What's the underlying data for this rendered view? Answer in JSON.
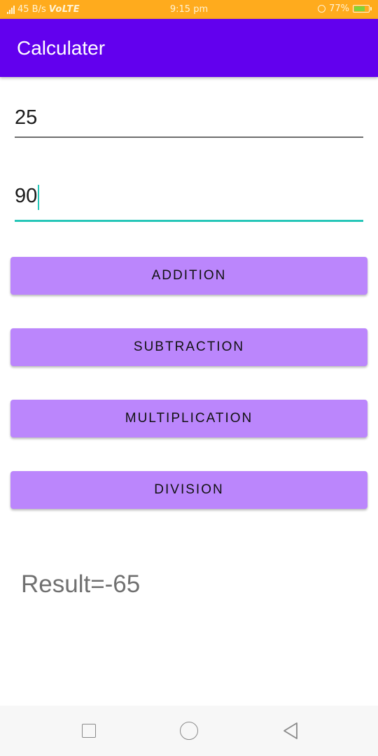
{
  "status_bar": {
    "speed": "45 B/s",
    "network": "VoLTE",
    "time": "9:15 pm",
    "battery_percent": "77%",
    "battery_level": 0.77,
    "icons": [
      "signal-icon",
      "alarm-icon",
      "battery-charging-icon"
    ]
  },
  "app_bar": {
    "title": "Calculater",
    "color": "#6200ee"
  },
  "inputs": {
    "first": {
      "value": "25"
    },
    "second": {
      "value": "90",
      "focused": true,
      "accent": "#26c6b8"
    }
  },
  "buttons": {
    "addition": "ADDITION",
    "subtraction": "SUBTRACTION",
    "multiplication": "MULTIPLICATION",
    "division": "DIVISION",
    "color": "#bb86fc"
  },
  "result": {
    "text": "Result=-65"
  },
  "nav_bar": {
    "icons": [
      "recent-apps-icon",
      "home-icon",
      "back-icon"
    ]
  }
}
